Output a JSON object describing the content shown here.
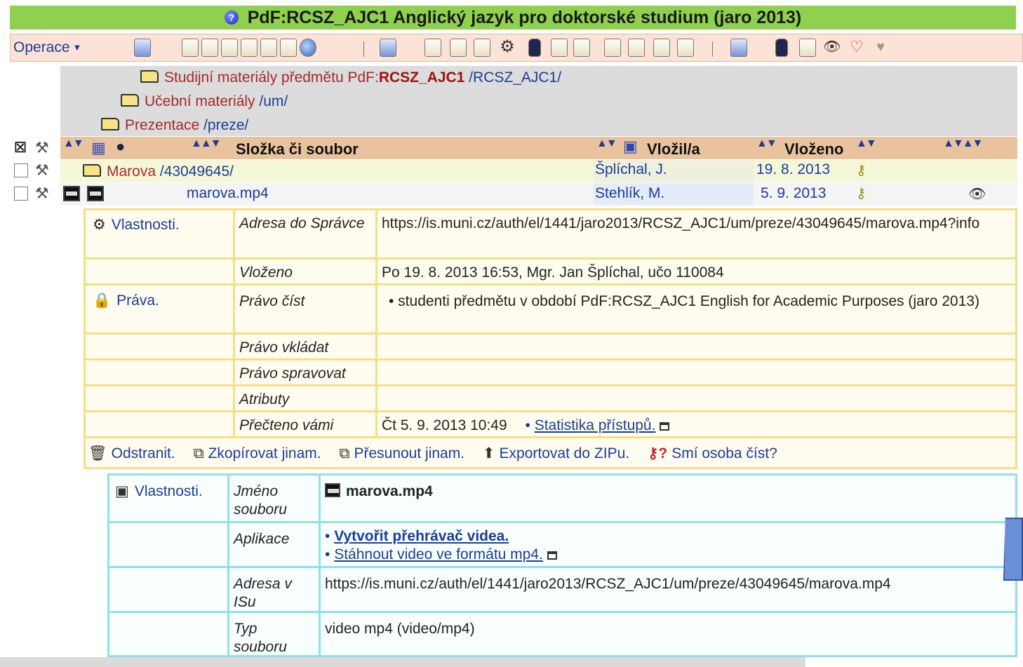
{
  "window": {
    "title": "PdF:RCSZ_AJC1 Anglický jazyk pro doktorské studium (jaro 2013)"
  },
  "toolbar": {
    "operations_label": "Operace"
  },
  "breadcrumbs": [
    {
      "label": "Studijní materiály předmětu PdF:",
      "bold": "RCSZ_AJC1",
      "path": " /RCSZ_AJC1/"
    },
    {
      "label": "Učební materiály",
      "path": " /um/"
    },
    {
      "label": "Prezentace",
      "path": " /preze/"
    }
  ],
  "table": {
    "col_name": "Složka či soubor",
    "col_author": "Vložil/a",
    "col_date": "Vloženo",
    "rows": [
      {
        "name": "Marova",
        "path": " /43049645/",
        "author": "Šplíchal, J.",
        "date": "19.  8. 2013"
      },
      {
        "name": "marova.mp4",
        "path": "",
        "author": "Stehlík, M.",
        "date": "5.  9. 2013"
      }
    ]
  },
  "properties": {
    "section_label": "Vlastnosti.",
    "rights_label": "Práva.",
    "rows": {
      "admin_url_label": "Adresa do Správce",
      "admin_url_value": "https://is.muni.cz/auth/el/1441/jaro2013/RCSZ_AJC1/um/preze/43049645/marova.mp4?info",
      "inserted_label": "Vloženo",
      "inserted_value": "Po 19. 8. 2013 16:53, Mgr. Jan Šplíchal, učo 110084",
      "read_label": "Právo číst",
      "read_value": "• studenti předmětu v období PdF:RCSZ_AJC1 English for Academic Purposes (jaro 2013)",
      "insert_label": "Právo vkládat",
      "manage_label": "Právo spravovat",
      "attrs_label": "Atributy",
      "read_by_you_label": "Přečteno vámi",
      "read_by_you_value": "Čt 5. 9. 2013 10:49",
      "stats_link": "Statistika přístupů."
    },
    "actions": {
      "delete": "Odstranit.",
      "copy": "Zkopírovat jinam.",
      "move": "Přesunout jinam.",
      "export": "Exportovat do ZIPu.",
      "may_read": "Smí osoba číst?"
    }
  },
  "file_props": {
    "section_label": "Vlastnosti.",
    "name_label": "Jméno souboru",
    "name_value": "marova.mp4",
    "app_label": "Aplikace",
    "app_link1": "Vytvořit přehrávač videa.",
    "app_link2": "Stáhnout video ve formátu mp4.",
    "isu_label": "Adresa v ISu",
    "isu_value": "https://is.muni.cz/auth/el/1441/jaro2013/RCSZ_AJC1/um/preze/43049645/marova.mp4",
    "type_label": "Typ souboru",
    "type_value": "video mp4 (video/mp4)"
  },
  "colors": {
    "title_bg": "#8fd14f",
    "toolbar_bg": "#fde3d6",
    "header_bg": "#e9c39e",
    "link": "#1a3d99"
  }
}
